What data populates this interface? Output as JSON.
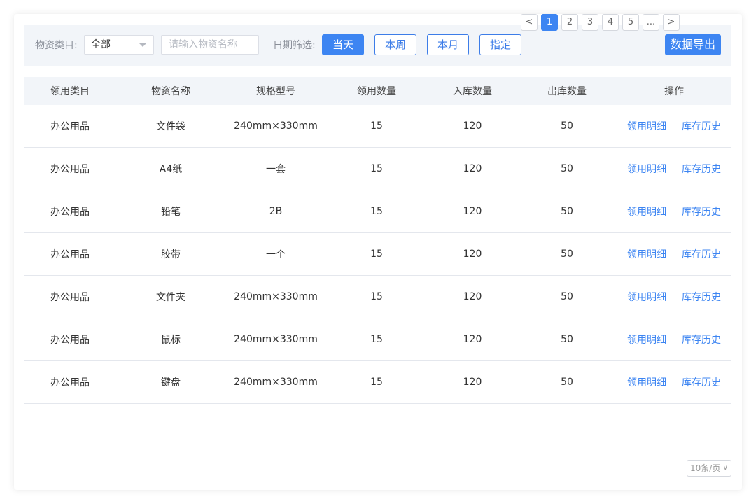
{
  "filters": {
    "category_label": "物资类目:",
    "category_value": "全部",
    "name_placeholder": "请输入物资名称",
    "date_label": "日期筛选:",
    "date_buttons": [
      "当天",
      "本周",
      "本月",
      "指定"
    ],
    "active_date": "当天",
    "export_label": "数据导出"
  },
  "table": {
    "headers": [
      "领用类目",
      "物资名称",
      "规格型号",
      "领用数量",
      "入库数量",
      "出库数量",
      "操作"
    ],
    "rows": [
      [
        "办公用品",
        "文件袋",
        "240mm×330mm",
        "15",
        "120",
        "50"
      ],
      [
        "办公用品",
        "A4纸",
        "一套",
        "15",
        "120",
        "50"
      ],
      [
        "办公用品",
        "铅笔",
        "2B",
        "15",
        "120",
        "50"
      ],
      [
        "办公用品",
        "胶带",
        "一个",
        "15",
        "120",
        "50"
      ],
      [
        "办公用品",
        "文件夹",
        "240mm×330mm",
        "15",
        "120",
        "50"
      ],
      [
        "办公用品",
        "鼠标",
        "240mm×330mm",
        "15",
        "120",
        "50"
      ],
      [
        "办公用品",
        "键盘",
        "240mm×330mm",
        "15",
        "120",
        "50"
      ]
    ],
    "actions": [
      "领用明细",
      "库存历史"
    ]
  },
  "pagination": {
    "prev": "<",
    "pages": [
      "1",
      "2",
      "3",
      "4",
      "5"
    ],
    "ellipsis": "...",
    "next": ">",
    "current": "1",
    "page_size": "10条/页",
    "page_size_icon": "chevron-down-icon"
  },
  "colors": {
    "accent": "#3d85f2",
    "header_bg": "#f2f5f9",
    "border": "#e4e7ed"
  }
}
